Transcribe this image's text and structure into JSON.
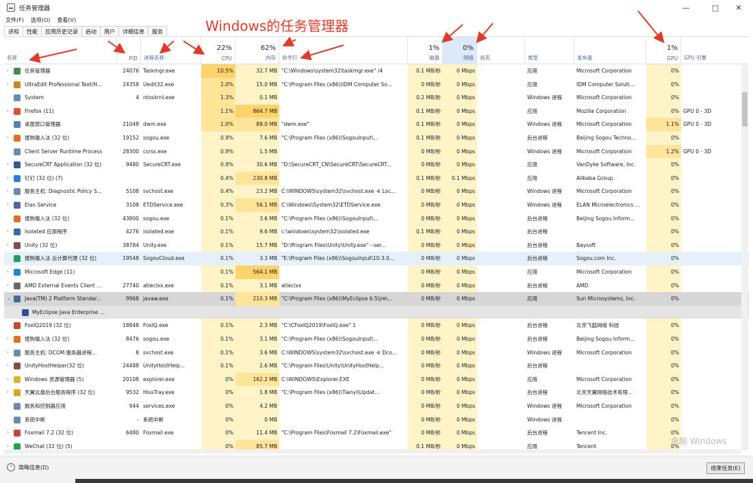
{
  "window": {
    "title": "任务管理器",
    "minimize": "—",
    "maximize": "□",
    "close": "✕"
  },
  "menu": [
    "文件(F)",
    "选项(O)",
    "查看(V)"
  ],
  "tabs": [
    "进程",
    "性能",
    "应用历史记录",
    "启动",
    "用户",
    "详细信息",
    "服务"
  ],
  "annotation": "Windows的任务管理器",
  "header": {
    "cpu_pct": "22%",
    "mem_pct": "62%",
    "disk_pct": "1%",
    "net_pct": "0%",
    "gpu_pct": "1%",
    "col_name": "名称",
    "col_pid": "PID",
    "col_proc": "进程名称",
    "col_cpu": "CPU",
    "col_mem": "内存",
    "col_cmd": "命令行",
    "col_disk": "磁盘",
    "col_net": "网络",
    "col_status": "状态",
    "col_type": "类型",
    "col_publisher": "发布者",
    "col_gpu": "GPU",
    "col_gpu_engine": "GPU 引擎"
  },
  "rows": [
    {
      "name": "任务管理器",
      "pid": "24076",
      "proc": "Taskmgr.exe",
      "cpu": "10.5%",
      "mem": "32.7 MB",
      "cmd": "\"C:\\Windows\\system32\\taskmgr.exe\" /4",
      "disk": "0.1 MB/秒",
      "net": "0 Mbps",
      "type": "应用",
      "pub": "Microsoft Corporation",
      "gpu": "0%",
      "eng": "",
      "icon": "#4a8a4a",
      "chev": "›"
    },
    {
      "name": "UltraEdit Professional Text/H...",
      "pid": "24358",
      "proc": "Uedit32.exe",
      "cpu": "2.0%",
      "mem": "15.0 MB",
      "cmd": "\"C:\\Program Files (x86)\\IDM Computer So...",
      "disk": "0 MB/秒",
      "net": "0 Mbps",
      "type": "应用",
      "pub": "IDM Computer Soluti...",
      "gpu": "0%",
      "eng": "",
      "icon": "#c98a1a",
      "chev": "›"
    },
    {
      "name": "System",
      "pid": "4",
      "proc": "ntoskrnl.exe",
      "cpu": "1.3%",
      "mem": "0.1 MB",
      "cmd": "",
      "disk": "0.2 MB/秒",
      "net": "0 Mbps",
      "type": "Windows 进程",
      "pub": "Microsoft Corporation",
      "gpu": "0%",
      "eng": "",
      "icon": "#6a8ab0",
      "chev": ""
    },
    {
      "name": "Firefox (11)",
      "pid": "",
      "proc": "",
      "cpu": "1.1%",
      "mem": "864.7 MB",
      "cmd": "",
      "disk": "0.1 MB/秒",
      "net": "0 Mbps",
      "type": "应用",
      "pub": "Mozilla Corporation",
      "gpu": "0%",
      "eng": "GPU 0 - 3D",
      "icon": "#e0502a",
      "chev": "›"
    },
    {
      "name": "桌面窗口管理器",
      "pid": "21048",
      "proc": "dwm.exe",
      "cpu": "1.0%",
      "mem": "88.0 MB",
      "cmd": "\"dwm.exe\"",
      "disk": "0.1 MB/秒",
      "net": "0 Mbps",
      "type": "Windows 进程",
      "pub": "Microsoft Corporation",
      "gpu": "1.1%",
      "eng": "GPU 0 - 3D",
      "icon": "#5a7fb0",
      "chev": ""
    },
    {
      "name": "搜狗输入法 (32 位)",
      "pid": "19152",
      "proc": "sogou.exe",
      "cpu": "0.9%",
      "mem": "7.6 MB",
      "cmd": "\"C:\\Program Files (x86)\\SogouInput\\...",
      "disk": "0.1 MB/秒",
      "net": "0 Mbps",
      "type": "后台进程",
      "pub": "Beijing Sogou Techno...",
      "gpu": "0%",
      "eng": "",
      "icon": "#e07020",
      "chev": "›"
    },
    {
      "name": "Client Server Runtime Process",
      "pid": "28300",
      "proc": "csrss.exe",
      "cpu": "0.9%",
      "mem": "1.5 MB",
      "cmd": "",
      "disk": "0 MB/秒",
      "net": "0 Mbps",
      "type": "Windows 进程",
      "pub": "Microsoft Corporation",
      "gpu": "1.2%",
      "eng": "GPU 0 - 3D",
      "icon": "#6a8ab0",
      "chev": ""
    },
    {
      "name": "SecureCRT Application (32 位)",
      "pid": "9480",
      "proc": "SecureCRT.exe",
      "cpu": "0.9%",
      "mem": "30.6 MB",
      "cmd": "\"D:\\SecureCRT_CN\\SecureCRT\\SecureCRT...",
      "disk": "0 MB/秒",
      "net": "0 Mbps",
      "type": "应用",
      "pub": "VanDyke Software, Inc.",
      "gpu": "0%",
      "eng": "",
      "icon": "#3a5a8a",
      "chev": "›"
    },
    {
      "name": "钉钉 (32 位) (7)",
      "pid": "",
      "proc": "",
      "cpu": "0.4%",
      "mem": "230.8 MB",
      "cmd": "",
      "disk": "0.1 MB/秒",
      "net": "0.1 Mbps",
      "type": "应用",
      "pub": "Alibaba Group.",
      "gpu": "0%",
      "eng": "",
      "icon": "#2a7ae0",
      "chev": "›"
    },
    {
      "name": "服务主机: Diagnostic Policy S...",
      "pid": "5108",
      "proc": "svchost.exe",
      "cpu": "0.4%",
      "mem": "23.2 MB",
      "cmd": "C:\\WINDOWS\\system32\\svchost.exe -k Loc...",
      "disk": "0 MB/秒",
      "net": "0 Mbps",
      "type": "Windows 进程",
      "pub": "Microsoft Corporation",
      "gpu": "0%",
      "eng": "",
      "icon": "#6a8ab0",
      "chev": "›"
    },
    {
      "name": "Elan Service",
      "pid": "3108",
      "proc": "ETDService.exe",
      "cpu": "0.3%",
      "mem": "56.1 MB",
      "cmd": "C:\\Windows\\System32\\ETDService.exe",
      "disk": "0 MB/秒",
      "net": "0 Mbps",
      "type": "Windows 进程",
      "pub": "ELAN Microelectronics ...",
      "gpu": "0%",
      "eng": "",
      "icon": "#4a6a9a",
      "chev": "›"
    },
    {
      "name": "搜狗输入法 (32 位)",
      "pid": "43800",
      "proc": "sogou.exe",
      "cpu": "0.1%",
      "mem": "3.6 MB",
      "cmd": "\"C:\\Program Files (x86)\\SogouInput\\...",
      "disk": "0 MB/秒",
      "net": "0 Mbps",
      "type": "后台进程",
      "pub": "Beijing Sogou Inform...",
      "gpu": "0%",
      "eng": "",
      "icon": "#e07020",
      "chev": ""
    },
    {
      "name": "Isolated 应用程序",
      "pid": "4276",
      "proc": "isolated.exe",
      "cpu": "0.1%",
      "mem": "9.6 MB",
      "cmd": "c:\\windows\\system32\\isolated.exe",
      "disk": "0.1 MB/秒",
      "net": "0 Mbps",
      "type": "后台进程",
      "pub": "",
      "gpu": "0%",
      "eng": "",
      "icon": "#3a6aa0",
      "chev": "›"
    },
    {
      "name": "Unity (32 位)",
      "pid": "38784",
      "proc": "Unity.exe",
      "cpu": "0.1%",
      "mem": "15.7 MB",
      "cmd": "\"D:\\Program Files\\Unity\\Unity.exe\" --ser...",
      "disk": "0 MB/秒",
      "net": "0 Mbps",
      "type": "后台进程",
      "pub": "Baysoft",
      "gpu": "0%",
      "eng": "",
      "icon": "#8a4a4a",
      "chev": "›"
    },
    {
      "name": "搜狗输入法 云计算代理 (32 位)",
      "pid": "19548",
      "proc": "SogouCloud.exe",
      "cpu": "0.1%",
      "mem": "3.3 MB",
      "cmd": "\"E:\\Program Files (x86)\\SogouInput\\10.3.0...",
      "disk": "0 MB/秒",
      "net": "0 Mbps",
      "type": "后台进程",
      "pub": "Sogou.com Inc.",
      "gpu": "0%",
      "eng": "",
      "icon": "#20a060",
      "chev": "",
      "state": "selected"
    },
    {
      "name": "Microsoft Edge (11)",
      "pid": "",
      "proc": "",
      "cpu": "0.1%",
      "mem": "564.1 MB",
      "cmd": "",
      "disk": "0 MB/秒",
      "net": "0 Mbps",
      "type": "应用",
      "pub": "Microsoft Corporation",
      "gpu": "0%",
      "eng": "",
      "icon": "#1a8ad0",
      "chev": "›"
    },
    {
      "name": "AMD External Events Client ...",
      "pid": "27740",
      "proc": "atieclxx.exe",
      "cpu": "0.1%",
      "mem": "3.1 MB",
      "cmd": "atieclxx",
      "disk": "0 MB/秒",
      "net": "0 Mbps",
      "type": "后台进程",
      "pub": "AMD",
      "gpu": "0%",
      "eng": "",
      "icon": "#6a6a6a",
      "chev": "›"
    },
    {
      "name": "Java(TM) 2 Platform Standar...",
      "pid": "9968",
      "proc": "javaw.exe",
      "cpu": "0.1%",
      "mem": "210.3 MB",
      "cmd": "\"C:\\Program Files (x86)\\MyEclipse 6.5\\jre\\...",
      "disk": "0 MB/秒",
      "net": "0 Mbps",
      "type": "应用",
      "pub": "Sun Microsystems, Inc.",
      "gpu": "0%",
      "eng": "",
      "icon": "#4a6a9a",
      "chev": "⌄",
      "state": "expanded"
    },
    {
      "name": "MyEclipse Java Enterprise ...",
      "pid": "",
      "proc": "",
      "cpu": "",
      "mem": "",
      "cmd": "",
      "disk": "",
      "net": "",
      "type": "",
      "pub": "",
      "gpu": "",
      "eng": "",
      "icon": "#3a4a9a",
      "chev": "",
      "state": "child"
    },
    {
      "name": "FoxIQ2019 (32 位)",
      "pid": "18848",
      "proc": "FoxIQ.exe",
      "cpu": "0.1%",
      "mem": "2.3 MB",
      "cmd": "\"C:\\CFoxIQ2019\\FoxIQ.exe\" 1",
      "disk": "0 MB/秒",
      "net": "0 Mbps",
      "type": "后台进程",
      "pub": "北京飞狐网络 科技",
      "gpu": "0%",
      "eng": "",
      "icon": "#c04a2a",
      "chev": ""
    },
    {
      "name": "搜狗输入法 (32 位)",
      "pid": "8476",
      "proc": "sogou.exe",
      "cpu": "0.1%",
      "mem": "3.1 MB",
      "cmd": "\"C:\\Program Files (x86)\\SogouInput\\...",
      "disk": "0 MB/秒",
      "net": "0 Mbps",
      "type": "后台进程",
      "pub": "Beijing Sogou Inform...",
      "gpu": "0%",
      "eng": "",
      "icon": "#e07020",
      "chev": "›"
    },
    {
      "name": "服务主机: DCOM 服务器进程...",
      "pid": "8",
      "proc": "svchost.exe",
      "cpu": "0.1%",
      "mem": "3.6 MB",
      "cmd": "C:\\WINDOWS\\system32\\svchost.exe -k Dco...",
      "disk": "0 MB/秒",
      "net": "0 Mbps",
      "type": "Windows 进程",
      "pub": "Microsoft Corporation",
      "gpu": "0%",
      "eng": "",
      "icon": "#6a8ab0",
      "chev": "›"
    },
    {
      "name": "UnityHostHelper(32 位)",
      "pid": "24488",
      "proc": "UnityHostHelp...",
      "cpu": "0.1%",
      "mem": "2.6 MB",
      "cmd": "\"C:\\Program Files\\Unity\\UnityHostHelp...",
      "disk": "0 MB/秒",
      "net": "0 Mbps",
      "type": "后台进程",
      "pub": "",
      "gpu": "0%",
      "eng": "",
      "icon": "#8a4a4a",
      "chev": "›"
    },
    {
      "name": "Windows 资源管理器 (5)",
      "pid": "20108",
      "proc": "explorer.exe",
      "cpu": "0%",
      "mem": "162.2 MB",
      "cmd": "C:\\WINDOWS\\Explorer.EXE",
      "disk": "0 MB/秒",
      "net": "0 Mbps",
      "type": "应用",
      "pub": "Microsoft Corporation",
      "gpu": "0%",
      "eng": "",
      "icon": "#e0b030",
      "chev": "›"
    },
    {
      "name": "天翼云盘后台服务程序 (32 位)",
      "pid": "9532",
      "proc": "HissTray.exe",
      "cpu": "0%",
      "mem": "1.8 MB",
      "cmd": "\"C:\\Program Files (x86)\\Tianyi\\Updat...",
      "disk": "0 MB/秒",
      "net": "0 Mbps",
      "type": "后台进程",
      "pub": "北京天翼网络技术有限...",
      "gpu": "0%",
      "eng": "",
      "icon": "#e0a020",
      "chev": "›"
    },
    {
      "name": "服务和控制器应用",
      "pid": "944",
      "proc": "services.exe",
      "cpu": "0%",
      "mem": "4.2 MB",
      "cmd": "",
      "disk": "0 MB/秒",
      "net": "0 Mbps",
      "type": "Windows 进程",
      "pub": "Microsoft Corporation",
      "gpu": "0%",
      "eng": "",
      "icon": "#6a8ab0",
      "chev": ""
    },
    {
      "name": "系统中断",
      "pid": "-",
      "proc": "系统中断",
      "cpu": "0%",
      "mem": "0 MB",
      "cmd": "",
      "disk": "0 MB/秒",
      "net": "0 Mbps",
      "type": "Windows 进程",
      "pub": "",
      "gpu": "0%",
      "eng": "",
      "icon": "#6a8ab0",
      "chev": ""
    },
    {
      "name": "Foxmail 7.2 (32 位)",
      "pid": "6480",
      "proc": "Foxmail.exe",
      "cpu": "0%",
      "mem": "11.4 MB",
      "cmd": "\"C:\\Program Files\\Foxmail 7.2\\Foxmail.exe\"",
      "disk": "0 MB/秒",
      "net": "0 Mbps",
      "type": "后台进程",
      "pub": "Tencent Inc.",
      "gpu": "0%",
      "eng": "",
      "icon": "#d04040",
      "chev": "›"
    },
    {
      "name": "WeChat (32 位) (5)",
      "pid": "",
      "proc": "",
      "cpu": "0%",
      "mem": "85.7 MB",
      "cmd": "",
      "disk": "0.1 MB/秒",
      "net": "0 Mbps",
      "type": "应用",
      "pub": "Tencent",
      "gpu": "0%",
      "eng": "",
      "icon": "#2aa04a",
      "chev": "›"
    }
  ],
  "footer": {
    "less_details": "简略信息(D)",
    "end_task": "结束任务(E)"
  },
  "watermark": "电脑 Windows"
}
